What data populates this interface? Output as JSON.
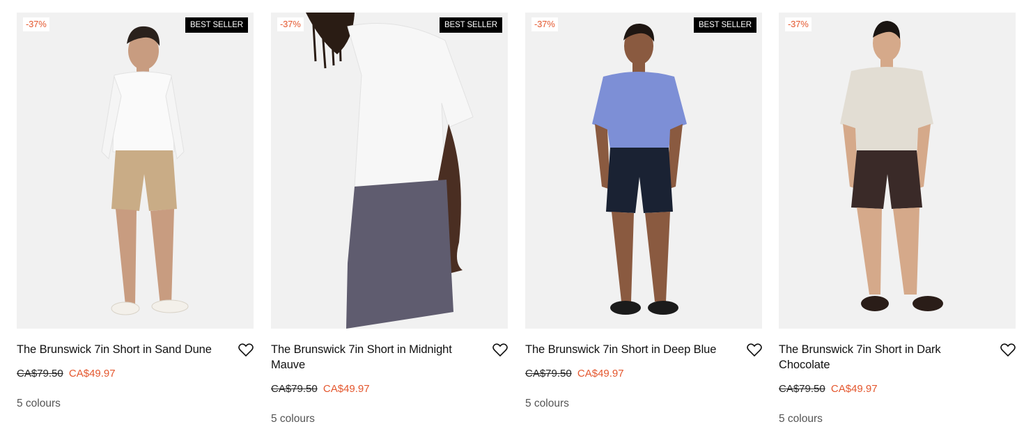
{
  "products": [
    {
      "discount": "-37%",
      "badge": "BEST SELLER",
      "title": "The Brunswick 7in Short in Sand Dune",
      "price_original": "CA$79.50",
      "price_sale": "CA$49.97",
      "colours": "5 colours",
      "shorts_color": "#c9ac86",
      "top_color": "#fafafa"
    },
    {
      "discount": "-37%",
      "badge": "BEST SELLER",
      "title": "The Brunswick 7in Short in Midnight Mauve",
      "price_original": "CA$79.50",
      "price_sale": "CA$49.97",
      "colours": "5 colours",
      "shorts_color": "#5f5c6f",
      "top_color": "#f7f7f7"
    },
    {
      "discount": "-37%",
      "badge": "BEST SELLER",
      "title": "The Brunswick 7in Short in Deep Blue",
      "price_original": "CA$79.50",
      "price_sale": "CA$49.97",
      "colours": "5 colours",
      "shorts_color": "#1a2233",
      "top_color": "#7d8fd6"
    },
    {
      "discount": "-37%",
      "badge": "",
      "title": "The Brunswick 7in Short in Dark Chocolate",
      "price_original": "CA$79.50",
      "price_sale": "CA$49.97",
      "colours": "5 colours",
      "shorts_color": "#3a2a28",
      "top_color": "#e2ddd3"
    }
  ],
  "colors": {
    "sale": "#e4572e",
    "image_bg": "#f1f1f1",
    "badge_bg": "#000000"
  },
  "icons": {
    "wishlist": "heart-outline-icon"
  }
}
